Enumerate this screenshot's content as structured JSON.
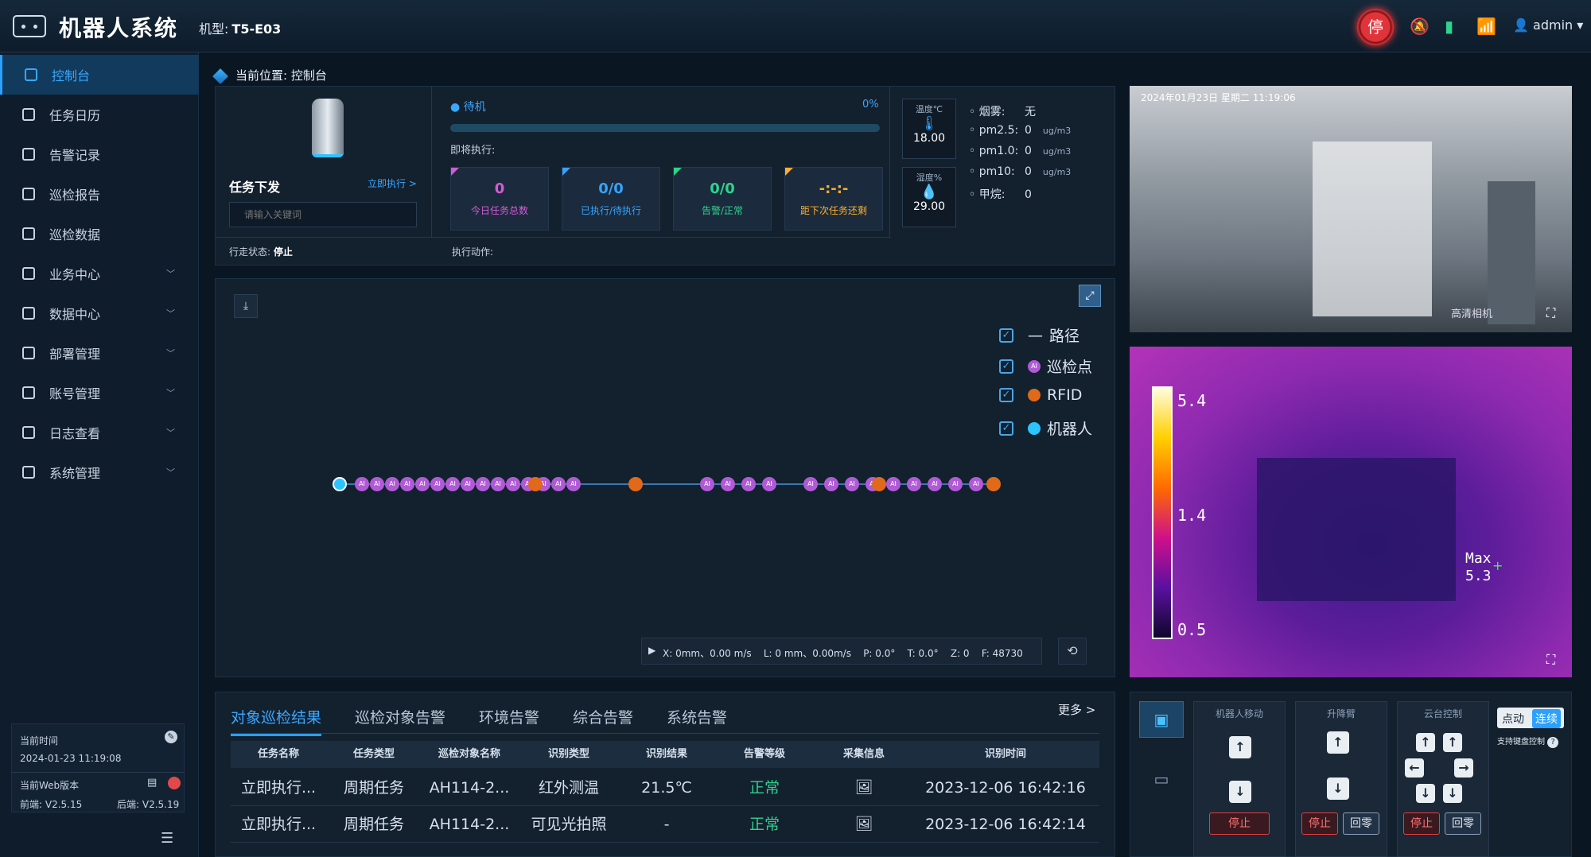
{
  "header": {
    "title": "机器人系统",
    "model_label": "机型:",
    "model_value": "T5-E03",
    "stop_label": "停",
    "user": "admin"
  },
  "sidebar": {
    "items": [
      {
        "label": "控制台",
        "icon": "console-icon"
      },
      {
        "label": "任务日历",
        "icon": "calendar-icon"
      },
      {
        "label": "告警记录",
        "icon": "alarm-icon"
      },
      {
        "label": "巡检报告",
        "icon": "report-icon"
      },
      {
        "label": "巡检数据",
        "icon": "data-icon"
      },
      {
        "label": "业务中心",
        "icon": "folder-icon"
      },
      {
        "label": "数据中心",
        "icon": "monitor-icon"
      },
      {
        "label": "部署管理",
        "icon": "deploy-icon"
      },
      {
        "label": "账号管理",
        "icon": "account-icon"
      },
      {
        "label": "日志查看",
        "icon": "log-icon"
      },
      {
        "label": "系统管理",
        "icon": "settings-icon"
      }
    ],
    "time_label": "当前时间",
    "time_value": "2024-01-23 11:19:08",
    "version_label": "当前Web版本",
    "frontend_label": "前端:",
    "frontend_version": "V2.5.15",
    "backend_label": "后端:",
    "backend_version": "V2.5.19"
  },
  "breadcrumb": {
    "label": "当前位置:",
    "value": "控制台"
  },
  "task": {
    "title": "任务下发",
    "execute_now": "立即执行 >",
    "search_placeholder": "请输入关键词",
    "walk_status_label": "行走状态:",
    "walk_status_value": "停止",
    "action_label": "执行动作:"
  },
  "progress": {
    "state": "待机",
    "percent": "0%",
    "upcoming_label": "即将执行:",
    "percent_value": 0
  },
  "stats": [
    {
      "value": "0",
      "label": "今日任务总数",
      "color": "#d65ad6"
    },
    {
      "value": "0/0",
      "label": "已执行/待执行",
      "color": "#36a3ff"
    },
    {
      "value": "0/0",
      "label": "告警/正常",
      "color": "#2fd38c"
    },
    {
      "value": "-:-:-",
      "label": "距下次任务还剩",
      "color": "#ffae2b"
    }
  ],
  "env": {
    "temp_label": "温度℃",
    "temp_value": "18.00",
    "hum_label": "湿度%",
    "hum_value": "29.00",
    "sensors": [
      {
        "key": "烟雾:",
        "value": "无",
        "unit": ""
      },
      {
        "key": "pm2.5:",
        "value": "0",
        "unit": "ug/m3"
      },
      {
        "key": "pm1.0:",
        "value": "0",
        "unit": "ug/m3"
      },
      {
        "key": "pm10:",
        "value": "0",
        "unit": "ug/m3"
      },
      {
        "key": "甲烷:",
        "value": "0",
        "unit": ""
      }
    ]
  },
  "map": {
    "legend": [
      {
        "label": "路径",
        "checked": true
      },
      {
        "label": "巡检点",
        "checked": true
      },
      {
        "label": "RFID",
        "checked": true
      },
      {
        "label": "机器人",
        "checked": true
      }
    ],
    "status": "X: 0mm、0.00 m/s    L: 0 mm、0.00m/s    P: 0.0°    T: 0.0°    Z: 0    F: 48730",
    "point_label": "AI"
  },
  "camera": {
    "timestamp": "2024年01月23日  星期二  11:19:06",
    "mode": "高清相机"
  },
  "thermal": {
    "scale": [
      "5.4",
      "1.4",
      "0.5"
    ],
    "max_label": "Max",
    "max_value": "5.3"
  },
  "results": {
    "tabs": [
      "对象巡检结果",
      "巡检对象告警",
      "环境告警",
      "综合告警",
      "系统告警"
    ],
    "more": "更多 >",
    "columns": [
      "任务名称",
      "任务类型",
      "巡检对象名称",
      "识别类型",
      "识别结果",
      "告警等级",
      "采集信息",
      "识别时间"
    ],
    "rows": [
      [
        "立即执行...",
        "周期任务",
        "AH114-2...",
        "红外测温",
        "21.5℃",
        "正常",
        "",
        "2023-12-06 16:42:16"
      ],
      [
        "立即执行...",
        "周期任务",
        "AH114-2...",
        "可见光拍照",
        "-",
        "正常",
        "",
        "2023-12-06 16:42:14"
      ]
    ]
  },
  "controls": {
    "robot_move": "机器人移动",
    "lift": "升降臂",
    "ptz": "云台控制",
    "stop": "停止",
    "reset": "回零",
    "mode_point": "点动",
    "mode_continuous": "连续",
    "keyboard_hint": "支持键盘控制"
  }
}
